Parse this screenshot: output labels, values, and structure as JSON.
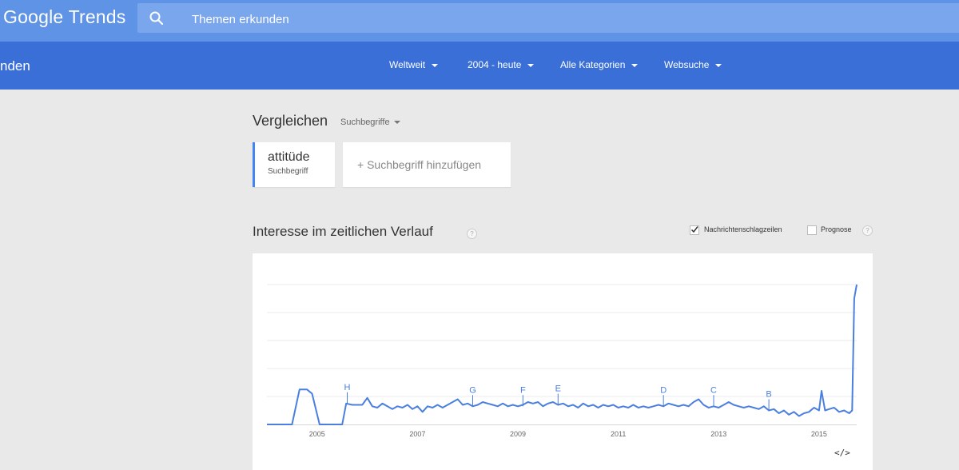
{
  "header": {
    "logo_google": "Google",
    "logo_trends": "Trends",
    "search_placeholder": "Themen erkunden"
  },
  "subbar": {
    "section": "nden",
    "filters": [
      "Weltweit",
      "2004 - heute",
      "Alle Kategorien",
      "Websuche"
    ]
  },
  "compare": {
    "title": "Vergleichen",
    "type_dropdown": "Suchbegriffe",
    "term": "attitüde",
    "term_type": "Suchbegriff",
    "add_term": "+ Suchbegriff hinzufügen"
  },
  "chart_section": {
    "title": "Interesse im zeitlichen Verlauf",
    "help": "?",
    "news_headlines_label": "Nachrichtenschlagzeilen",
    "news_headlines_checked": true,
    "forecast_label": "Prognose",
    "forecast_checked": false,
    "embed_label": "</>"
  },
  "colors": {
    "line": "#4a7fe0",
    "topbar": "#5f93e6",
    "subbar": "#3a6fd8",
    "accent": "#4285f4"
  },
  "chart_data": {
    "type": "line",
    "title": "",
    "xlabel": "",
    "ylabel": "",
    "xlim": [
      2004.0,
      2015.75
    ],
    "ylim": [
      0,
      100
    ],
    "x_ticks": [
      2005,
      2007,
      2009,
      2011,
      2013,
      2015
    ],
    "series": [
      {
        "values": [
          [
            2004.0,
            0
          ],
          [
            2004.5,
            0
          ],
          [
            2004.65,
            25
          ],
          [
            2004.8,
            25
          ],
          [
            2004.9,
            22
          ],
          [
            2005.05,
            0
          ],
          [
            2005.5,
            0
          ],
          [
            2005.58,
            15
          ],
          [
            2005.7,
            14
          ],
          [
            2005.9,
            14
          ],
          [
            2006.0,
            19
          ],
          [
            2006.1,
            13
          ],
          [
            2006.2,
            12
          ],
          [
            2006.3,
            15
          ],
          [
            2006.4,
            13
          ],
          [
            2006.5,
            11
          ],
          [
            2006.6,
            13
          ],
          [
            2006.7,
            12
          ],
          [
            2006.8,
            14
          ],
          [
            2006.9,
            11
          ],
          [
            2007.0,
            13
          ],
          [
            2007.1,
            9
          ],
          [
            2007.2,
            13
          ],
          [
            2007.3,
            12
          ],
          [
            2007.4,
            14
          ],
          [
            2007.5,
            12
          ],
          [
            2007.6,
            14
          ],
          [
            2007.7,
            16
          ],
          [
            2007.8,
            18
          ],
          [
            2007.9,
            14
          ],
          [
            2008.0,
            15
          ],
          [
            2008.1,
            13
          ],
          [
            2008.2,
            14
          ],
          [
            2008.3,
            16
          ],
          [
            2008.4,
            15
          ],
          [
            2008.5,
            14
          ],
          [
            2008.6,
            13
          ],
          [
            2008.7,
            15
          ],
          [
            2008.8,
            13
          ],
          [
            2008.9,
            14
          ],
          [
            2009.0,
            13
          ],
          [
            2009.1,
            14
          ],
          [
            2009.2,
            16
          ],
          [
            2009.3,
            15
          ],
          [
            2009.4,
            16
          ],
          [
            2009.5,
            13
          ],
          [
            2009.6,
            15
          ],
          [
            2009.7,
            16
          ],
          [
            2009.8,
            14
          ],
          [
            2009.9,
            15
          ],
          [
            2010.0,
            13
          ],
          [
            2010.1,
            14
          ],
          [
            2010.2,
            12
          ],
          [
            2010.3,
            15
          ],
          [
            2010.4,
            13
          ],
          [
            2010.5,
            14
          ],
          [
            2010.6,
            12
          ],
          [
            2010.7,
            14
          ],
          [
            2010.8,
            13
          ],
          [
            2010.9,
            14
          ],
          [
            2011.0,
            12
          ],
          [
            2011.1,
            13
          ],
          [
            2011.2,
            12
          ],
          [
            2011.3,
            14
          ],
          [
            2011.4,
            12
          ],
          [
            2011.5,
            13
          ],
          [
            2011.6,
            12
          ],
          [
            2011.7,
            13
          ],
          [
            2011.8,
            14
          ],
          [
            2011.9,
            13
          ],
          [
            2012.0,
            15
          ],
          [
            2012.1,
            14
          ],
          [
            2012.2,
            13
          ],
          [
            2012.3,
            14
          ],
          [
            2012.4,
            13
          ],
          [
            2012.5,
            16
          ],
          [
            2012.6,
            18
          ],
          [
            2012.7,
            14
          ],
          [
            2012.8,
            12
          ],
          [
            2012.9,
            13
          ],
          [
            2013.0,
            12
          ],
          [
            2013.1,
            14
          ],
          [
            2013.2,
            16
          ],
          [
            2013.3,
            14
          ],
          [
            2013.4,
            13
          ],
          [
            2013.5,
            12
          ],
          [
            2013.6,
            13
          ],
          [
            2013.7,
            12
          ],
          [
            2013.8,
            11
          ],
          [
            2013.9,
            13
          ],
          [
            2014.0,
            10
          ],
          [
            2014.1,
            11
          ],
          [
            2014.2,
            8
          ],
          [
            2014.3,
            10
          ],
          [
            2014.4,
            7
          ],
          [
            2014.5,
            9
          ],
          [
            2014.6,
            6
          ],
          [
            2014.7,
            8
          ],
          [
            2014.8,
            9
          ],
          [
            2014.9,
            12
          ],
          [
            2015.0,
            10
          ],
          [
            2015.05,
            24
          ],
          [
            2015.12,
            10
          ],
          [
            2015.2,
            11
          ],
          [
            2015.3,
            12
          ],
          [
            2015.4,
            9
          ],
          [
            2015.5,
            10
          ],
          [
            2015.6,
            8
          ],
          [
            2015.66,
            10
          ],
          [
            2015.7,
            90
          ],
          [
            2015.75,
            100
          ]
        ]
      }
    ],
    "annotations": [
      {
        "label": "H",
        "x": 2005.6,
        "y": 15
      },
      {
        "label": "G",
        "x": 2008.1,
        "y": 13
      },
      {
        "label": "F",
        "x": 2009.1,
        "y": 13
      },
      {
        "label": "E",
        "x": 2009.8,
        "y": 14
      },
      {
        "label": "D",
        "x": 2011.9,
        "y": 13
      },
      {
        "label": "C",
        "x": 2012.9,
        "y": 13
      },
      {
        "label": "B",
        "x": 2014.0,
        "y": 10
      }
    ],
    "grid": true,
    "legend": "none"
  }
}
